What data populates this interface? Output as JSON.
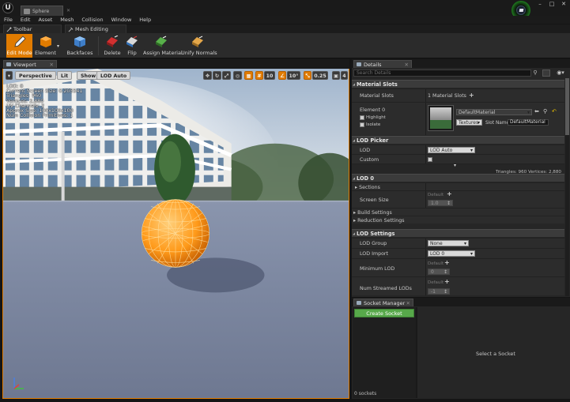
{
  "document_tab": {
    "label": "Sphere"
  },
  "window_controls": {
    "minimize": "–",
    "maximize": "□",
    "close": "✕"
  },
  "menu": [
    "File",
    "Edit",
    "Asset",
    "Mesh",
    "Collision",
    "Window",
    "Help"
  ],
  "mode_tabs": {
    "toolbar": "Toolbar",
    "mesh_editing": "Mesh Editing"
  },
  "toolbar": {
    "edit_mode": "Edit Mode",
    "element": "Element",
    "backfaces": "Backfaces",
    "delete": "Delete",
    "flip": "Flip",
    "assign_material": "Assign Material",
    "unify_normals": "Unify Normals"
  },
  "viewport": {
    "tab_label": "Viewport",
    "perspective": "Perspective",
    "lit": "Lit",
    "show": "Show",
    "lod": "LOD Auto",
    "grid_snap": "10",
    "rot_snap": "10°",
    "scale_snap": "0.25",
    "cam_speed": "4",
    "stats": [
      "LOD: 0",
      "Current Screen Size: 0.205541",
      "Triangles: 960",
      "Vertices: 2,880",
      "UV Channels: 2",
      "Approx Size: 100x100x100",
      "Num Collision Primitives: 1"
    ]
  },
  "details": {
    "tab_label": "Details",
    "search_placeholder": "Search Details",
    "material_slots": {
      "header": "Material Slots",
      "label": "Material Slots",
      "value": "1 Material Slots",
      "element": "Element 0",
      "highlight": "Highlight",
      "isolate": "Isolate",
      "material": "DefaultMaterial",
      "textures": "Textures",
      "slot_name_label": "Slot Name",
      "slot_name": "DefaultMaterial"
    },
    "lod_picker": {
      "header": "LOD Picker",
      "lod_label": "LOD",
      "lod_value": "LOD Auto",
      "custom_label": "Custom",
      "tri_info": "Triangles: 960   Vertices: 2,880"
    },
    "lod0": {
      "header": "LOD 0",
      "sections": "Sections",
      "screen_size_label": "Screen Size",
      "default": "Default",
      "screen_size_value": "1.0",
      "build_settings": "Build Settings",
      "reduction_settings": "Reduction Settings"
    },
    "lod_settings": {
      "header": "LOD Settings",
      "lod_group_label": "LOD Group",
      "lod_group_value": "None",
      "lod_import_label": "LOD Import",
      "lod_import_value": "LOD 0",
      "min_lod_label": "Minimum LOD",
      "min_lod_default": "Default",
      "min_lod_value": "0",
      "num_streamed_label": "Num Streamed LODs",
      "num_streamed_default": "Default",
      "num_streamed_value": "-1"
    }
  },
  "socket_manager": {
    "tab_label": "Socket Manager",
    "create": "Create Socket",
    "count": "0 sockets",
    "empty": "Select a Socket"
  },
  "colors": {
    "accent": "#e07b00",
    "create_socket": "#57a84a",
    "wire": "#ff9a1a"
  }
}
